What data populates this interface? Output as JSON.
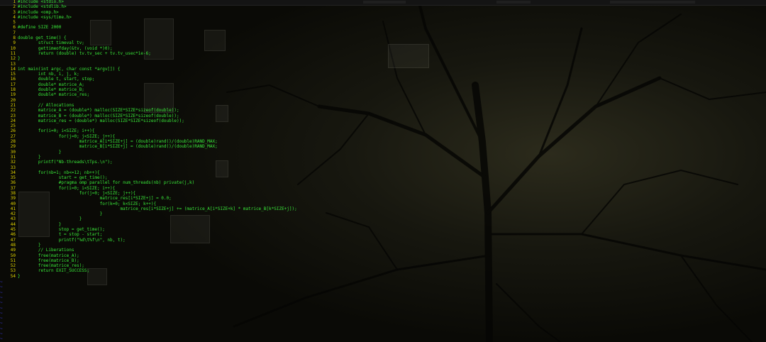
{
  "editor": {
    "lines": [
      {
        "n": "1",
        "text": "#include <stdio.h>"
      },
      {
        "n": "2",
        "text": "#include <stdlib.h>"
      },
      {
        "n": "3",
        "text": "#include <omp.h>"
      },
      {
        "n": "4",
        "text": "#include <sys/time.h>"
      },
      {
        "n": "5",
        "text": ""
      },
      {
        "n": "6",
        "text": "#define SIZE 2000"
      },
      {
        "n": "7",
        "text": ""
      },
      {
        "n": "8",
        "text": "double get_time() {"
      },
      {
        "n": "9",
        "text": "        struct timeval tv;"
      },
      {
        "n": "10",
        "text": "        gettimeofday(&tv, (void *)0);"
      },
      {
        "n": "11",
        "text": "        return (double) tv.tv_sec + tv.tv_usec*1e-6;"
      },
      {
        "n": "12",
        "text": "}"
      },
      {
        "n": "13",
        "text": ""
      },
      {
        "n": "14",
        "text": "int main(int argc, char const *argv[]) {"
      },
      {
        "n": "15",
        "text": "        int nb, i, j, k;"
      },
      {
        "n": "16",
        "text": "        double t, start, stop;"
      },
      {
        "n": "17",
        "text": "        double* matrice_A;"
      },
      {
        "n": "18",
        "text": "        double* matrice_B;"
      },
      {
        "n": "19",
        "text": "        double* matrice_res;"
      },
      {
        "n": "20",
        "text": ""
      },
      {
        "n": "21",
        "text": "        // Allocations"
      },
      {
        "n": "22",
        "text": "        matrice_A = (double*) malloc(SIZE*SIZE*sizeof(double));"
      },
      {
        "n": "23",
        "text": "        matrice_B = (double*) malloc(SIZE*SIZE*sizeof(double));"
      },
      {
        "n": "24",
        "text": "        matrice_res = (double*) malloc(SIZE*SIZE*sizeof(double));"
      },
      {
        "n": "25",
        "text": ""
      },
      {
        "n": "26",
        "text": "        for(i=0; i<SIZE; i++){"
      },
      {
        "n": "27",
        "text": "                for(j=0; j<SIZE; j++){"
      },
      {
        "n": "28",
        "text": "                        matrice_A[i*SIZE+j] = (double)rand()/(double)RAND_MAX;"
      },
      {
        "n": "29",
        "text": "                        matrice_B[i*SIZE+j] = (double)rand()/(double)RAND_MAX;"
      },
      {
        "n": "30",
        "text": "                }"
      },
      {
        "n": "31",
        "text": "        }"
      },
      {
        "n": "32",
        "text": "        printf(\"Nb-threads\\tTps.\\n\");"
      },
      {
        "n": "33",
        "text": ""
      },
      {
        "n": "34",
        "text": "        for(nb=1; nb<=12; nb++){"
      },
      {
        "n": "35",
        "text": "                start = get_time();"
      },
      {
        "n": "36",
        "text": "                #pragma omp parallel for num_threads(nb) private(j,k)"
      },
      {
        "n": "37",
        "text": "                for(i=0; i<SIZE; i++){"
      },
      {
        "n": "38",
        "text": "                        for(j=0; j<SIZE; j++){"
      },
      {
        "n": "39",
        "text": "                                matrice_res[i*SIZE+j] = 0.0;"
      },
      {
        "n": "40",
        "text": "                                for(k=0; k<SIZE; k++){"
      },
      {
        "n": "41",
        "text": "                                        matrice_res[i*SIZE+j] += (matrice_A[i*SIZE+k] * matrice_B[k*SIZE+j]);"
      },
      {
        "n": "42",
        "text": "                                }"
      },
      {
        "n": "43",
        "text": "                        }"
      },
      {
        "n": "44",
        "text": "                }"
      },
      {
        "n": "45",
        "text": "                stop = get_time();"
      },
      {
        "n": "46",
        "text": "                t = stop - start;"
      },
      {
        "n": "47",
        "text": "                printf(\"%d\\t%f\\n\", nb, t);"
      },
      {
        "n": "48",
        "text": "        }"
      },
      {
        "n": "49",
        "text": "        // Liberations"
      },
      {
        "n": "50",
        "text": "        free(matrice_A);"
      },
      {
        "n": "51",
        "text": "        free(matrice_B);"
      },
      {
        "n": "52",
        "text": "        free(matrice_res);"
      },
      {
        "n": "53",
        "text": "        return EXIT_SUCCESS;"
      },
      {
        "n": "54",
        "text": "}"
      }
    ],
    "empty_marker": "~",
    "colors": {
      "code": "#39e839",
      "line_numbers": "#e6d800",
      "empty_marker": "#3a3ad8",
      "background": "#0b0b07"
    }
  }
}
